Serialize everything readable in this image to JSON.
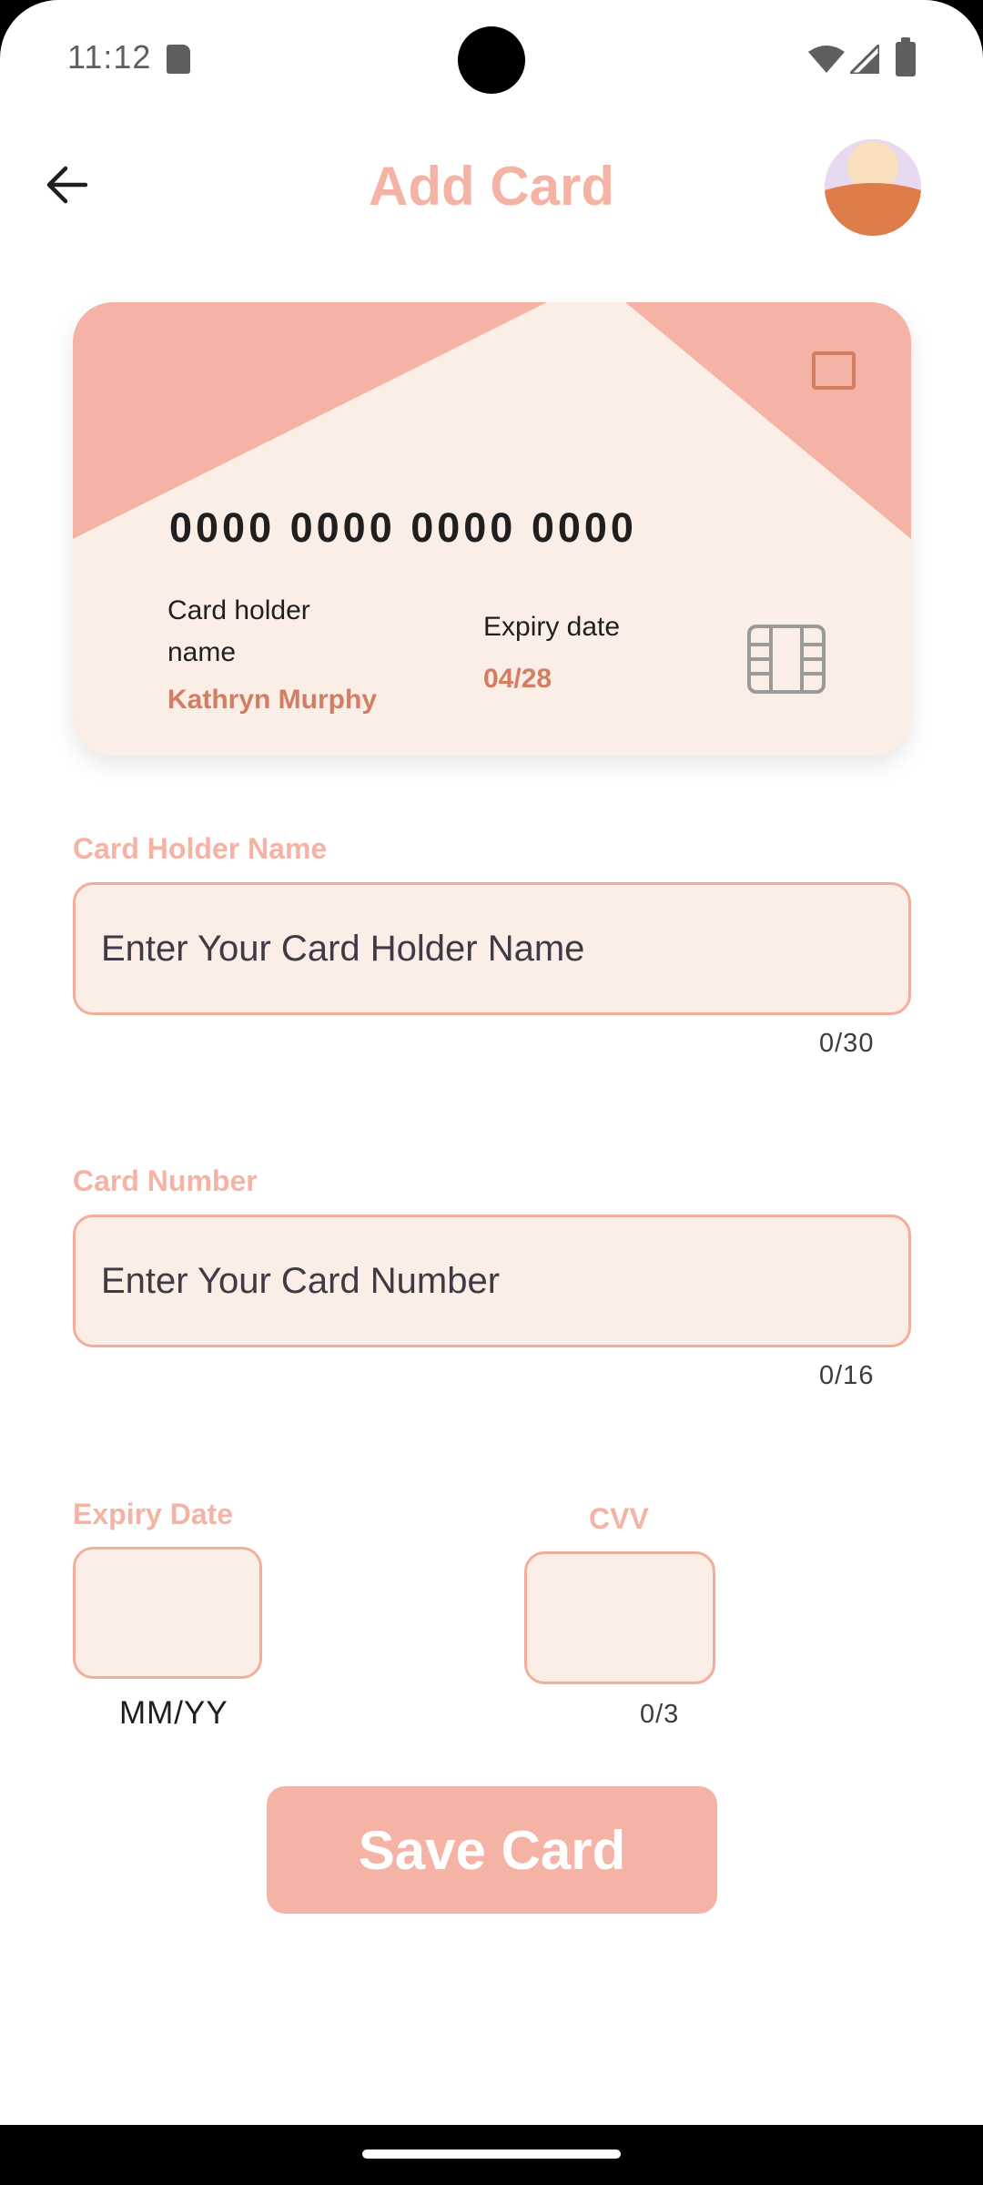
{
  "status_bar": {
    "time": "11:12",
    "icons": [
      "sd-card-icon",
      "wifi-icon",
      "cell-signal-icon",
      "battery-icon"
    ]
  },
  "app_bar": {
    "title": "Add Card",
    "back_icon": "arrow-back-icon",
    "avatar": "user-avatar"
  },
  "card_preview": {
    "number": "0000 0000 0000 0000",
    "holder_label": "Card holder name",
    "holder_value": "Kathryn Murphy",
    "expiry_label": "Expiry date",
    "expiry_value": "04/28",
    "chip_icon": "card-chip-icon"
  },
  "form": {
    "holder_name": {
      "label": "Card Holder Name",
      "placeholder": "Enter Your Card Holder Name",
      "counter": "0/30"
    },
    "card_number": {
      "label": "Card Number",
      "placeholder": "Enter Your Card Number",
      "counter": "0/16"
    },
    "expiry": {
      "label": "Expiry Date",
      "hint": "MM/YY"
    },
    "cvv": {
      "label": "CVV",
      "counter": "0/3"
    }
  },
  "actions": {
    "save_label": "Save Card"
  },
  "colors": {
    "accent": "#f4b3a4",
    "accent_dark": "#d37d63",
    "field_bg": "#faeee6",
    "card_bg": "#faeee6"
  }
}
